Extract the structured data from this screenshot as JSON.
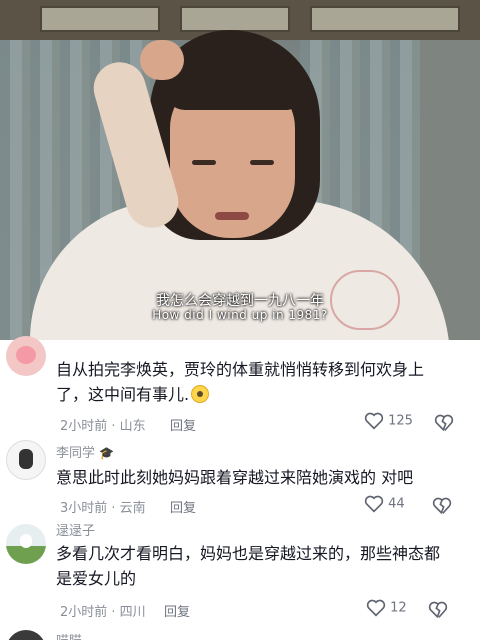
{
  "video": {
    "subtitle_cn": "我怎么会穿越到一九八一年",
    "subtitle_en": "How did I wind up in 1981?"
  },
  "comments": [
    {
      "username": "",
      "text_line1": "自从拍完李焕英，贾玲的体重就悄悄转移到何欢身上",
      "text_line2": "了，这中间有事儿.",
      "time": "2小时前 · 山东",
      "reply": "回复",
      "likes": "125"
    },
    {
      "username": "李同学",
      "text_line1": "意思此时此刻她妈妈跟着穿越过来陪她演戏的 对吧",
      "time": "3小时前 · 云南",
      "reply": "回复",
      "likes": "44"
    },
    {
      "username": "逯逯子",
      "text_line1": "多看几次才看明白，妈妈也是穿越过来的，那些神态都",
      "text_line2": "是爱女儿的",
      "time": "2小时前 · 四川",
      "reply": "回复",
      "likes": "12"
    },
    {
      "username": "喵瞄"
    }
  ],
  "colors": {
    "text": "#161823",
    "meta": "#8a8f99"
  }
}
